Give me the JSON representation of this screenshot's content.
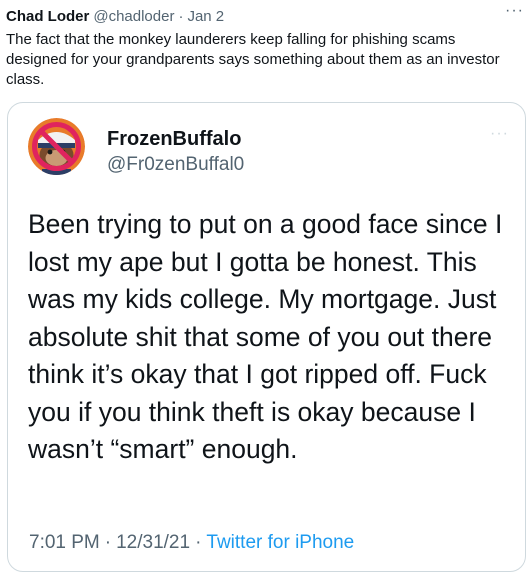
{
  "tweet": {
    "author_name": "Chad Loder",
    "author_handle": "@chadloder",
    "separator": "·",
    "date": "Jan 2",
    "more_icon": "···",
    "text": "The fact that the monkey launderers keep falling for phishing scams designed for your grandparents says something about them as an investor class."
  },
  "quoted": {
    "author_name": "FrozenBuffalo",
    "author_handle": "@Fr0zenBuffal0",
    "more_icon": "···",
    "text": "Been trying to put on a good face since I lost my ape but I gotta be honest. This was my kids college. My mortgage. Just absolute shit that some of you out there think it’s okay that I got ripped off. Fuck you if you think theft is okay because I wasn’t “smart” enough.",
    "time": "7:01 PM",
    "separator1": "·",
    "date": "12/31/21",
    "separator2": "·",
    "source": "Twitter for iPhone"
  },
  "colors": {
    "text_primary": "#0f1419",
    "text_secondary": "#536471",
    "link": "#1d9bf0",
    "border": "#cfd9de",
    "avatar_bg": "#e87b2a",
    "avatar_slash": "#e0245e"
  },
  "icons": {
    "avatar": "ape-avatar-with-prohibition-icon",
    "more": "more-horizontal-icon"
  }
}
